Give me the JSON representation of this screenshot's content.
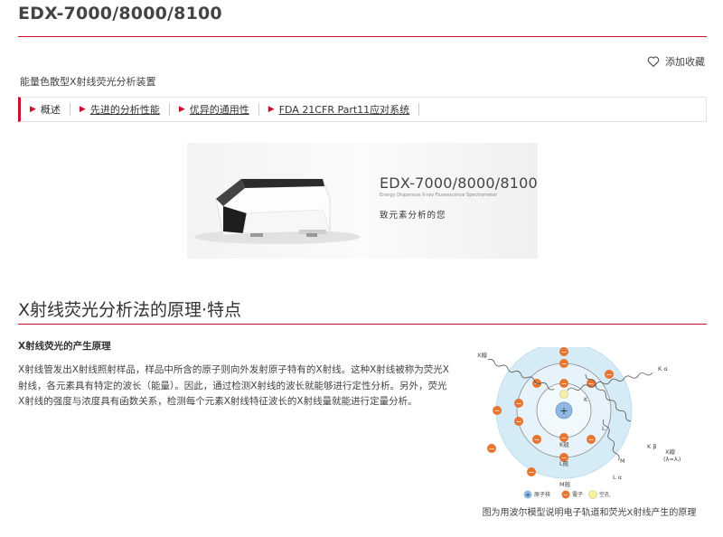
{
  "page": {
    "title": "EDX-7000/8000/8100",
    "favorite_label": "添加收藏",
    "subtitle": "能量色散型X射线荧光分析装置"
  },
  "tabs": [
    {
      "label": "概述",
      "link": false
    },
    {
      "label": "先进的分析性能",
      "link": true
    },
    {
      "label": "优异的通用性",
      "link": true
    },
    {
      "label": "FDA 21CFR Part11应对系统",
      "link": true
    }
  ],
  "hero": {
    "product_name": "EDX-7000/8000/8100",
    "english_name": "Energy Dispersive X-ray Fluorescence Spectrometer",
    "slogan": "致元素分析的您"
  },
  "section": {
    "title": "X射线荧光分析法的原理·特点",
    "subheading": "X射线荧光的产生原理",
    "paragraph": "X射线管发出X射线照射样品，样品中所含的原子则向外发射原子特有的X射线。这种X射线被称为荧光X射线，各元素具有特定的波长（能量）。因此，通过检测X射线的波长就能够进行定性分析。另外，荧光X射线的强度与浓度具有函数关系，检测每个元素X射线特征波长的X射线量就能进行定量分析。"
  },
  "diagram": {
    "labels": {
      "xray_in": "X線",
      "k_alpha": "K α",
      "k_beta": "K β",
      "l_alpha": "L α",
      "xray_out": "X線",
      "xray_out_formula": "(λ=λᵢ)",
      "shell_k": "K",
      "shell_l": "L",
      "shell_m": "M",
      "shell_k_label": "K殻",
      "shell_l_label": "L殻",
      "shell_m_label": "M殻"
    },
    "legend": {
      "nucleus": "原子核",
      "electron": "電子",
      "vacancy": "空孔"
    },
    "colors": {
      "nucleus": "#8fb8e3",
      "electron": "#e8742f",
      "vacancy": "#f5f2a8",
      "outer": "#d5ebf6"
    }
  },
  "caption": "图为用波尔模型说明电子轨道和荧光X射线产生的原理"
}
